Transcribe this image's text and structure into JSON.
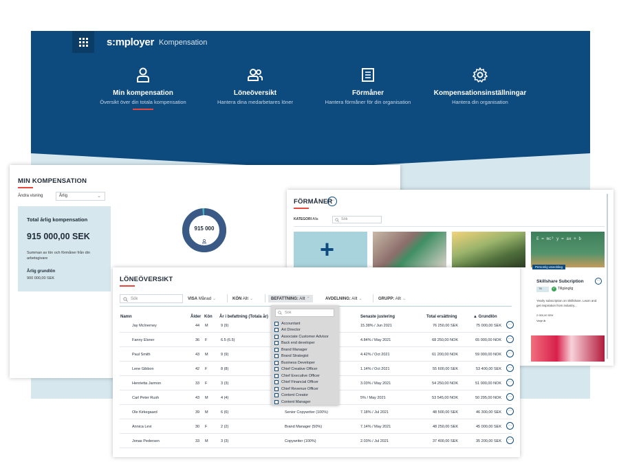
{
  "app": {
    "logo": "s:mployer",
    "title": "Kompensation",
    "nav": [
      {
        "label": "Min kompensation",
        "sub": "Översikt över din totala kompensation"
      },
      {
        "label": "Löneöversikt",
        "sub": "Hantera dina medarbetares löner"
      },
      {
        "label": "Förmåner",
        "sub": "Hantera förmåner för din organisation"
      },
      {
        "label": "Kompensationsinställningar",
        "sub": "Hantera din organisation"
      }
    ]
  },
  "min_kompensation": {
    "title": "MIN KOMPENSATION",
    "view_label": "Ändra visning",
    "view_value": "Årlig",
    "total_label": "Total årlig kompensation",
    "total_value": "915 000,00 SEK",
    "total_desc": "Summan av lön och förmåner från din arbetsgivare",
    "base_label": "Årlig grundlön",
    "base_value": "900 000,00 SEK",
    "donut_value": "915 000",
    "donut_base_fraction": 0.984
  },
  "formaner": {
    "title": "FÖRMÅNER",
    "category_label": "KATEGORI",
    "category_value": "Alla",
    "search_placeholder": "Sök",
    "chalk_text": "E = mc²  y = ax + b",
    "tag": "Personlig utveckling",
    "card_title": "Skillshare Subcription",
    "chip": "Till",
    "available": "Tillgänglig",
    "description": "Yearly subscription on Skillshare. Learn and get inspiration from industry...",
    "price": "2 000,00 SEK",
    "frequency": "Varje år"
  },
  "loneoversikt": {
    "title": "LÖNEÖVERSIKT",
    "search_placeholder": "Sök",
    "filters": [
      {
        "label": "VISA",
        "value": "Månad"
      },
      {
        "label": "KÖN",
        "value": "Allt"
      },
      {
        "label": "BEFATTNING:",
        "value": "Allt"
      },
      {
        "label": "AVDELNING:",
        "value": "Allt"
      },
      {
        "label": "GRUPP:",
        "value": "Allt"
      }
    ],
    "headers": {
      "namn": "Namn",
      "alder": "Ålder",
      "kon": "Kön",
      "ar": "År i befattning (Totala år)",
      "senaste": "Senaste justering",
      "total": "Total ersättning",
      "grundlon": "Grundlön",
      "sort_icon": "▲"
    },
    "rows": [
      {
        "namn": "Jay McInerney",
        "alder": "44",
        "kon": "M",
        "ar": "9 (9)",
        "bef": "",
        "sen": "15.38% / Jun 2021",
        "tot": "76 250,00 SEK",
        "gl": "75 000,00 SEK"
      },
      {
        "namn": "Fanny Elsner",
        "alder": "36",
        "kon": "F",
        "ar": "6.5 (6.5)",
        "bef": "",
        "sen": "4.84% / May 2021",
        "tot": "68 250,00 NOK",
        "gl": "65 000,00 NOK"
      },
      {
        "namn": "Paul Smith",
        "alder": "43",
        "kon": "M",
        "ar": "9 (9)",
        "bef": "",
        "sen": "4.42% / Oct 2021",
        "tot": "61 200,00 NOK",
        "gl": "59 000,00 NOK"
      },
      {
        "namn": "Lene Gibbon",
        "alder": "42",
        "kon": "F",
        "ar": "8 (8)",
        "bef": "",
        "sen": "1.14% / Oct 2021",
        "tot": "55 600,00 SEK",
        "gl": "53 400,00 SEK"
      },
      {
        "namn": "Henrietta Jarmon",
        "alder": "33",
        "kon": "F",
        "ar": "3 (3)",
        "bef": "",
        "sen": "3.03% / May 2021",
        "tot": "54 250,00 NOK",
        "gl": "51 000,00 NOK"
      },
      {
        "namn": "Carl Peter Rush",
        "alder": "43",
        "kon": "M",
        "ar": "4 (4)",
        "bef": "",
        "sen": "5% / May 2021",
        "tot": "53 545,00 NOK",
        "gl": "50 295,00 NOK"
      },
      {
        "namn": "Ole Kirkegaard",
        "alder": "39",
        "kon": "M",
        "ar": "6 (6)",
        "bef": "Senior Copywriter (100%)",
        "sen": "7.18% / Jul 2021",
        "tot": "48 500,00 SEK",
        "gl": "46 300,00 SEK"
      },
      {
        "namn": "Annica Levi",
        "alder": "30",
        "kon": "F",
        "ar": "2 (2)",
        "bef": "Brand Manager (50%)",
        "sen": "7.14% / May 2021",
        "tot": "48 250,00 SEK",
        "gl": "45 000,00 SEK"
      },
      {
        "namn": "Jonas Pedersen",
        "alder": "33",
        "kon": "M",
        "ar": "3 (3)",
        "bef": "Copywriter (100%)",
        "sen": "2.03% / Jul 2021",
        "tot": "37 400,00 SEK",
        "gl": "35 200,00 SEK"
      }
    ],
    "dropdown": {
      "search_placeholder": "Sök",
      "options": [
        "Accountant",
        "Art Director",
        "Associate Customer Advisor",
        "Back end developer",
        "Brand Manager",
        "Brand Strategist",
        "Business Developer",
        "Chief Creative Officer",
        "Chief Executive Officer",
        "Chief Financial Officer",
        "Chief Revenue Officer",
        "Content Creator",
        "Content Manager"
      ]
    }
  },
  "colors": {
    "brand": "#0d4a7e",
    "accent": "#e8473d",
    "light_panel": "#d6e8ee"
  }
}
